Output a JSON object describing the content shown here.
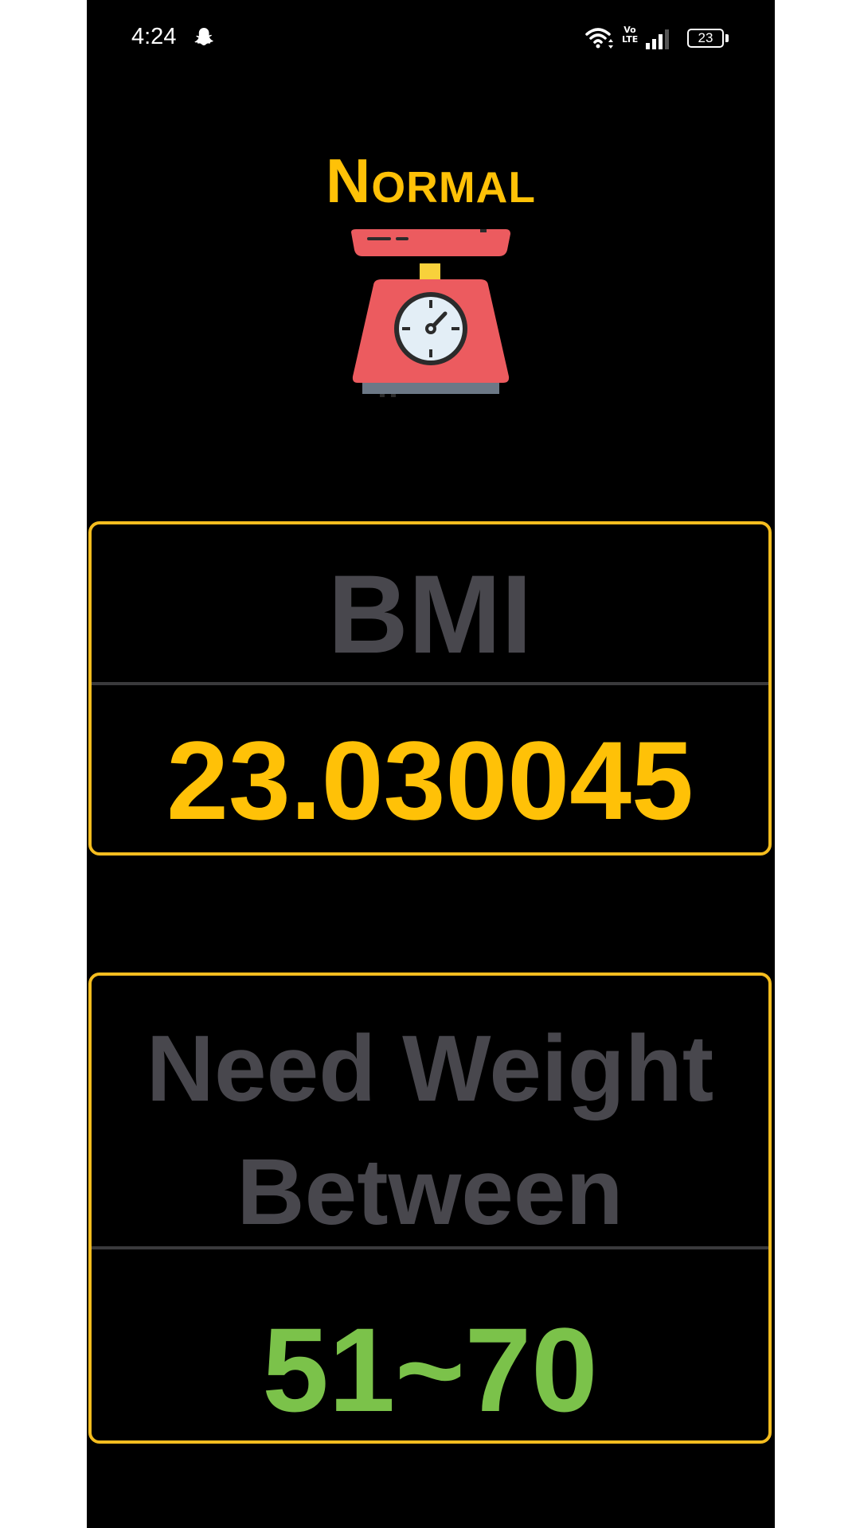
{
  "status_bar": {
    "time": "4:24",
    "network_badge": "Vo\nLTE",
    "battery": "23"
  },
  "result": {
    "category": "Normal",
    "category_color": "#ffc107",
    "icon": "kitchen-scale-icon"
  },
  "bmi_card": {
    "label": "BMI",
    "value": "23.030045",
    "value_color": "#ffc107",
    "border_color": "#f5bd1f"
  },
  "weight_card": {
    "label_line1": "Need Weight",
    "label_line2": "Between",
    "value": "51~70",
    "value_color": "#7bc24a"
  }
}
